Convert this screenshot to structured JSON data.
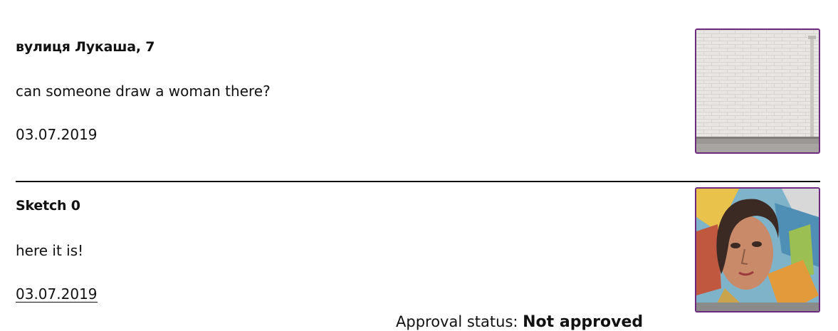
{
  "posts": [
    {
      "title": "вулиця Лукаша, 7",
      "text": "can someone draw a woman there?",
      "date": "03.07.2019",
      "image": "brick-wall-photo"
    },
    {
      "title": "Sketch 0",
      "text": "here it is!",
      "date": "03.07.2019",
      "image": "mural-woman-photo"
    }
  ],
  "approval": {
    "label": "Approval status: ",
    "value": "Not approved"
  },
  "colors": {
    "thumb_border": "#6b2a7d",
    "divider": "#111111",
    "text": "#111111"
  }
}
